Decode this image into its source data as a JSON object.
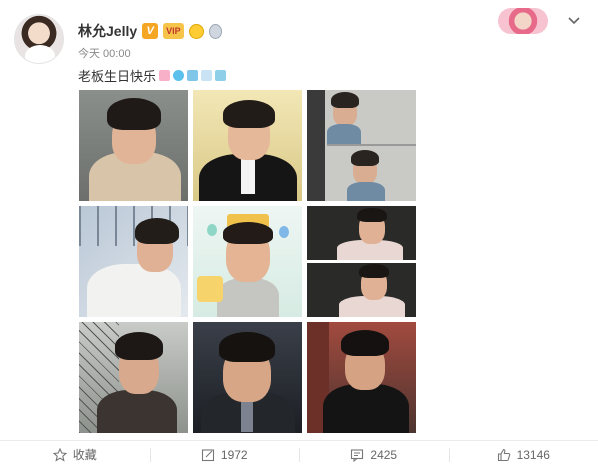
{
  "post": {
    "username": "林允Jelly",
    "verified_badge": "V",
    "vip_badge": "VIP",
    "time": "今天 00:00",
    "text": "老板生日快乐",
    "text_emojis": [
      "cake-emoji",
      "balloon-emoji",
      "gift-emoji",
      "ribbon-emoji",
      "confetti-emoji"
    ]
  },
  "header_icons": [
    "avatar-pendant-icon",
    "chevron-down-icon"
  ],
  "photos": [
    {
      "name": "photo-1",
      "description": "young man in beige jacket smiling"
    },
    {
      "name": "photo-2",
      "description": "young man in black tuxedo with bow tie"
    },
    {
      "name": "photo-3",
      "description": "two photos of man leaning on window"
    },
    {
      "name": "photo-4",
      "description": "man in white shirt lying down"
    },
    {
      "name": "photo-5",
      "description": "man laughing with birthday cake and crown"
    },
    {
      "name": "photo-6",
      "description": "two photos of man in checked shirt"
    },
    {
      "name": "photo-7",
      "description": "man in dark jacket by fence"
    },
    {
      "name": "photo-8",
      "description": "man in suit and tie looking down"
    },
    {
      "name": "photo-9",
      "description": "man in black leather jacket"
    }
  ],
  "footer": {
    "favorite_label": "收藏",
    "repost_count": "1972",
    "comment_count": "2425",
    "like_count": "13146"
  },
  "colors": {
    "accent": "#f5a623",
    "text": "#333333",
    "muted": "#888888"
  }
}
